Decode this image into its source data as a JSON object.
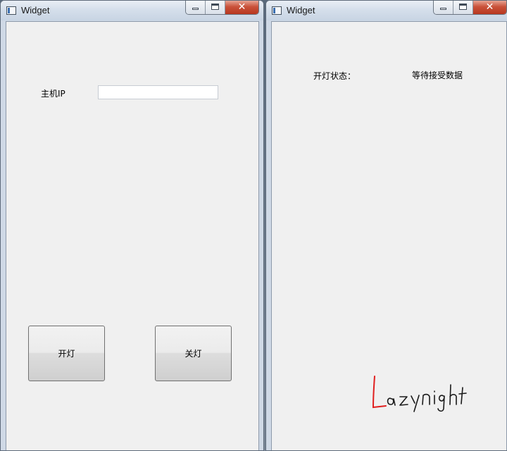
{
  "left_window": {
    "title": "Widget",
    "host_label": "主机IP",
    "host_input": {
      "value": "",
      "placeholder": ""
    },
    "buttons": {
      "light_on": "开灯",
      "light_off": "关灯"
    }
  },
  "right_window": {
    "title": "Widget",
    "status_label": "开灯状态：",
    "status_value": "等待接受数据",
    "signature_text": "Lazynight"
  },
  "window_controls": {
    "minimize_icon": "minimize-icon",
    "maximize_icon": "maximize-icon",
    "close_icon": "close-icon",
    "close_glyph": "✕"
  },
  "colors": {
    "client_background": "#f0f0f0",
    "close_button": "#c9523a",
    "signature_ink": "#e02020"
  }
}
